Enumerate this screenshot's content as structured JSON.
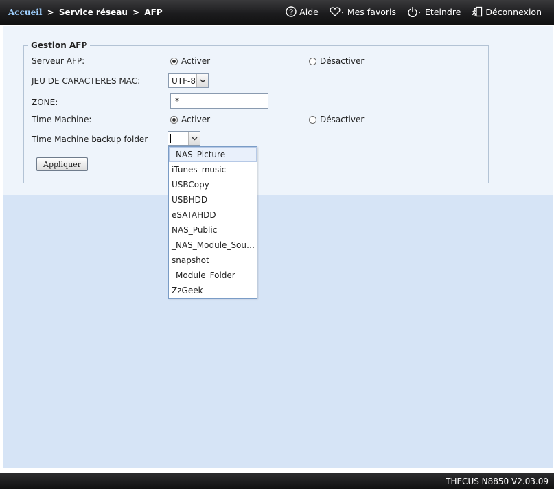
{
  "breadcrumb": {
    "home": "Accueil",
    "separator": ">",
    "section": "Service réseau",
    "page": "AFP"
  },
  "toplinks": {
    "help": "Aide",
    "favorites": "Mes favoris",
    "shutdown": "Eteindre",
    "logout": "Déconnexion"
  },
  "form": {
    "legend": "Gestion AFP",
    "afp_server": {
      "label": "Serveur AFP:",
      "enable": "Activer",
      "disable": "Désactiver",
      "selected": "enable"
    },
    "charset": {
      "label": "JEU DE CARACTERES MAC:",
      "value": "UTF-8"
    },
    "zone": {
      "label": "ZONE:",
      "value": "*"
    },
    "time_machine": {
      "label": "Time Machine:",
      "enable": "Activer",
      "disable": "Désactiver",
      "selected": "enable"
    },
    "backup_folder": {
      "label": "Time Machine backup folder",
      "value": "",
      "options": [
        "_NAS_Picture_",
        "iTunes_music",
        "USBCopy",
        "USBHDD",
        "eSATAHDD",
        "NAS_Public",
        "_NAS_Module_Sour...",
        "snapshot",
        "_Module_Folder_",
        "ZzGeek"
      ],
      "highlighted_index": 0
    },
    "apply_button": "Appliquer"
  },
  "footer": {
    "version": "THECUS N8850 V2.03.09"
  },
  "colors": {
    "topbar": "#1c1c1e",
    "panel_bg": "#d6e4f6",
    "form_bg": "#eef4fb",
    "link_home": "#9fd0ff"
  }
}
